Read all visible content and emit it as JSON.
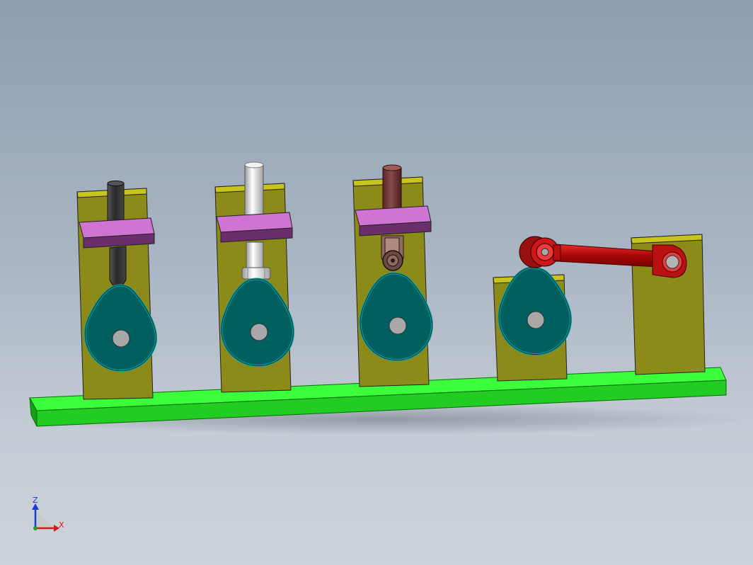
{
  "viewport": {
    "background_top": "#8e9db0",
    "background_bottom": "#cdd3da"
  },
  "colors": {
    "base": "#22dd22",
    "plate": "#8c8a18",
    "plate_edge": "#c9c41a",
    "guide_block": "#b05db3",
    "cam": "#006060",
    "cam_edge": "#0aa5a5",
    "hub": "#a8a8a8",
    "rod_knife": "#3a3a3a",
    "rod_flat": "#d8d8d8",
    "rod_roller": "#7a3a3a",
    "rocker_arm": "#cc1111"
  },
  "mechanisms": [
    {
      "id": 1,
      "follower": "knife-edge"
    },
    {
      "id": 2,
      "follower": "flat-face"
    },
    {
      "id": 3,
      "follower": "roller"
    },
    {
      "id": 4,
      "follower": "rocker-arm"
    }
  ],
  "triad": {
    "z_label": "Z",
    "x_label": "X",
    "z_color": "#1a3ad6",
    "x_color": "#d61a1a"
  }
}
